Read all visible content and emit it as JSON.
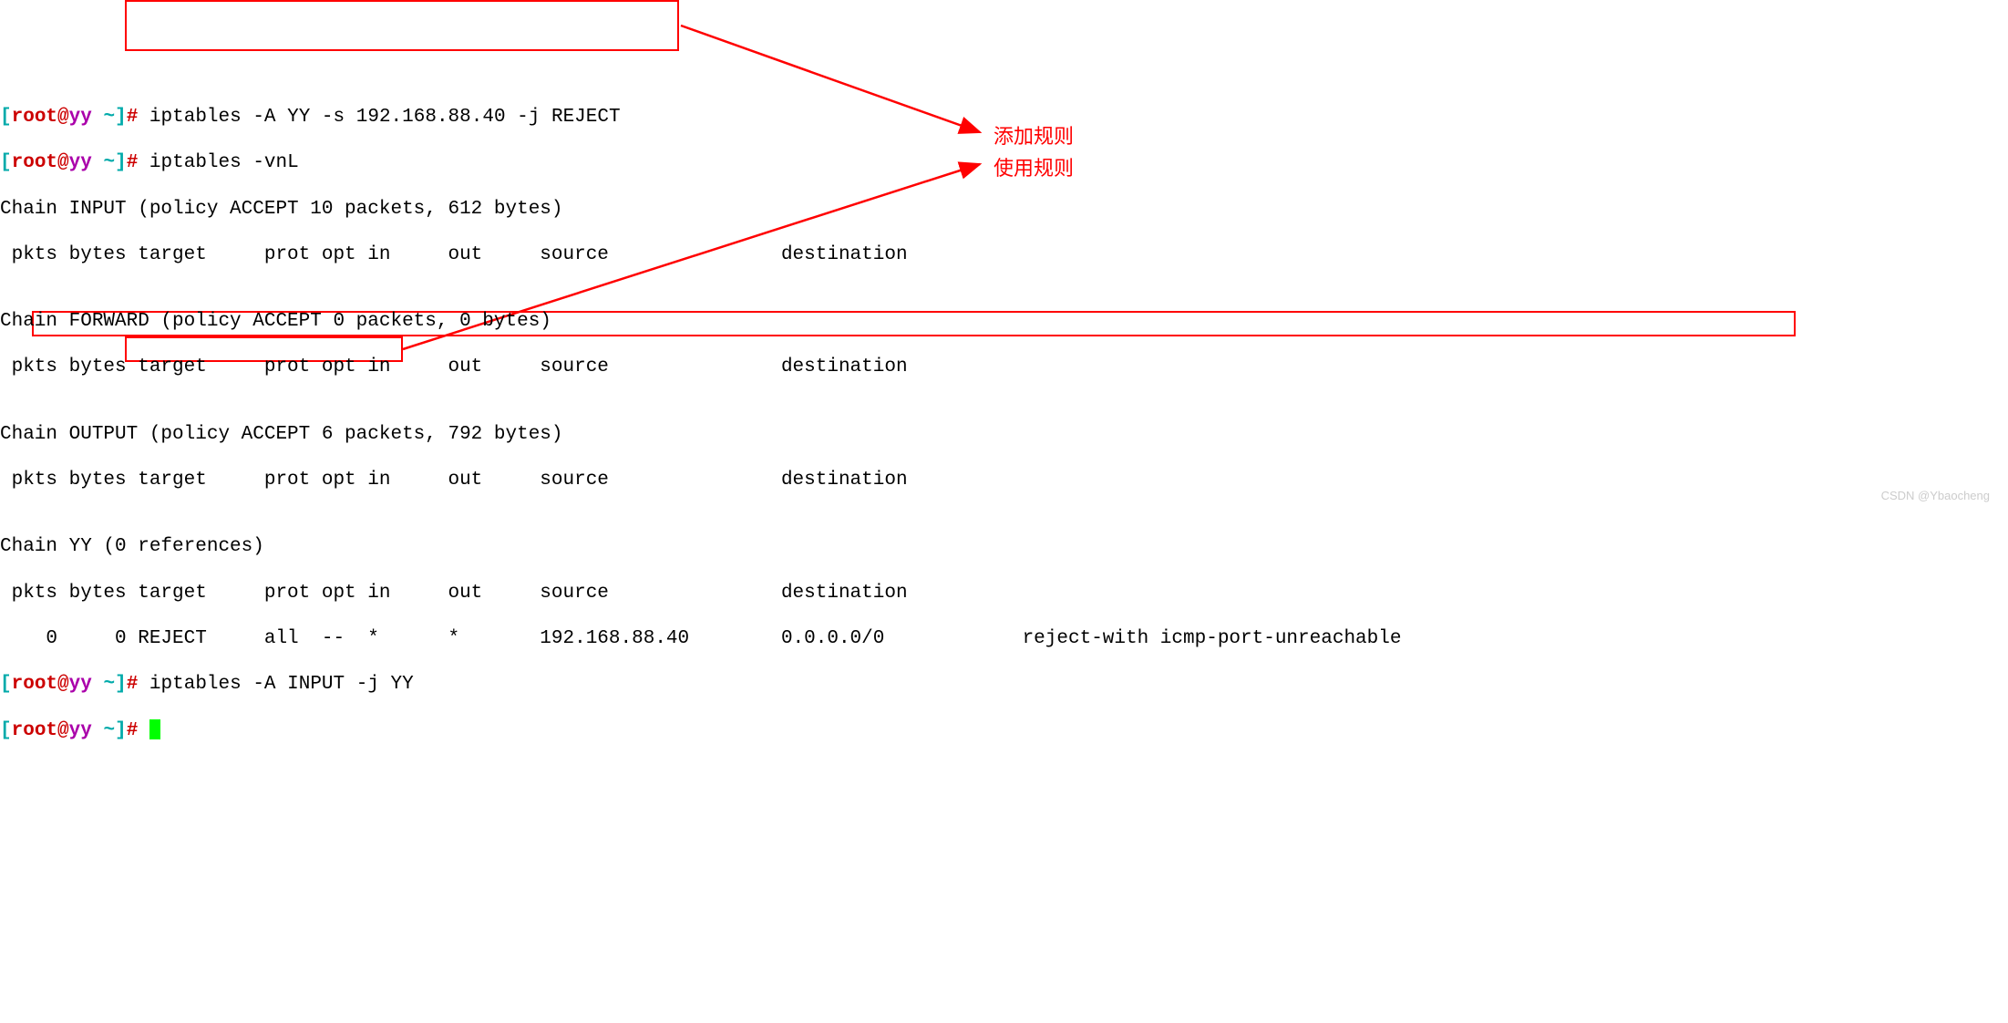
{
  "prompt": {
    "lbracket": "[",
    "user": "root",
    "at": "@",
    "host": "yy",
    "space_tilde": " ~",
    "rbracket": "]",
    "hash": "# "
  },
  "commands": {
    "cmd1": "iptables -A YY -s 192.168.88.40 -j REJECT",
    "cmd2": "iptables -vnL",
    "cmd3": "iptables -A INPUT -j YY"
  },
  "output": {
    "chain_input": "Chain INPUT (policy ACCEPT 10 packets, 612 bytes)",
    "header": " pkts bytes target     prot opt in     out     source               destination",
    "blank": "",
    "chain_forward": "Chain FORWARD (policy ACCEPT 0 packets, 0 bytes)",
    "chain_output": "Chain OUTPUT (policy ACCEPT 6 packets, 792 bytes)",
    "chain_yy": "Chain YY (0 references)",
    "yy_rule": "    0     0 REJECT     all  --  *      *       192.168.88.40        0.0.0.0/0            reject-with icmp-port-unreachable"
  },
  "annotations": {
    "add_rule": "添加规则",
    "use_rule": "使用规则"
  },
  "watermark": "CSDN @Ybaocheng"
}
